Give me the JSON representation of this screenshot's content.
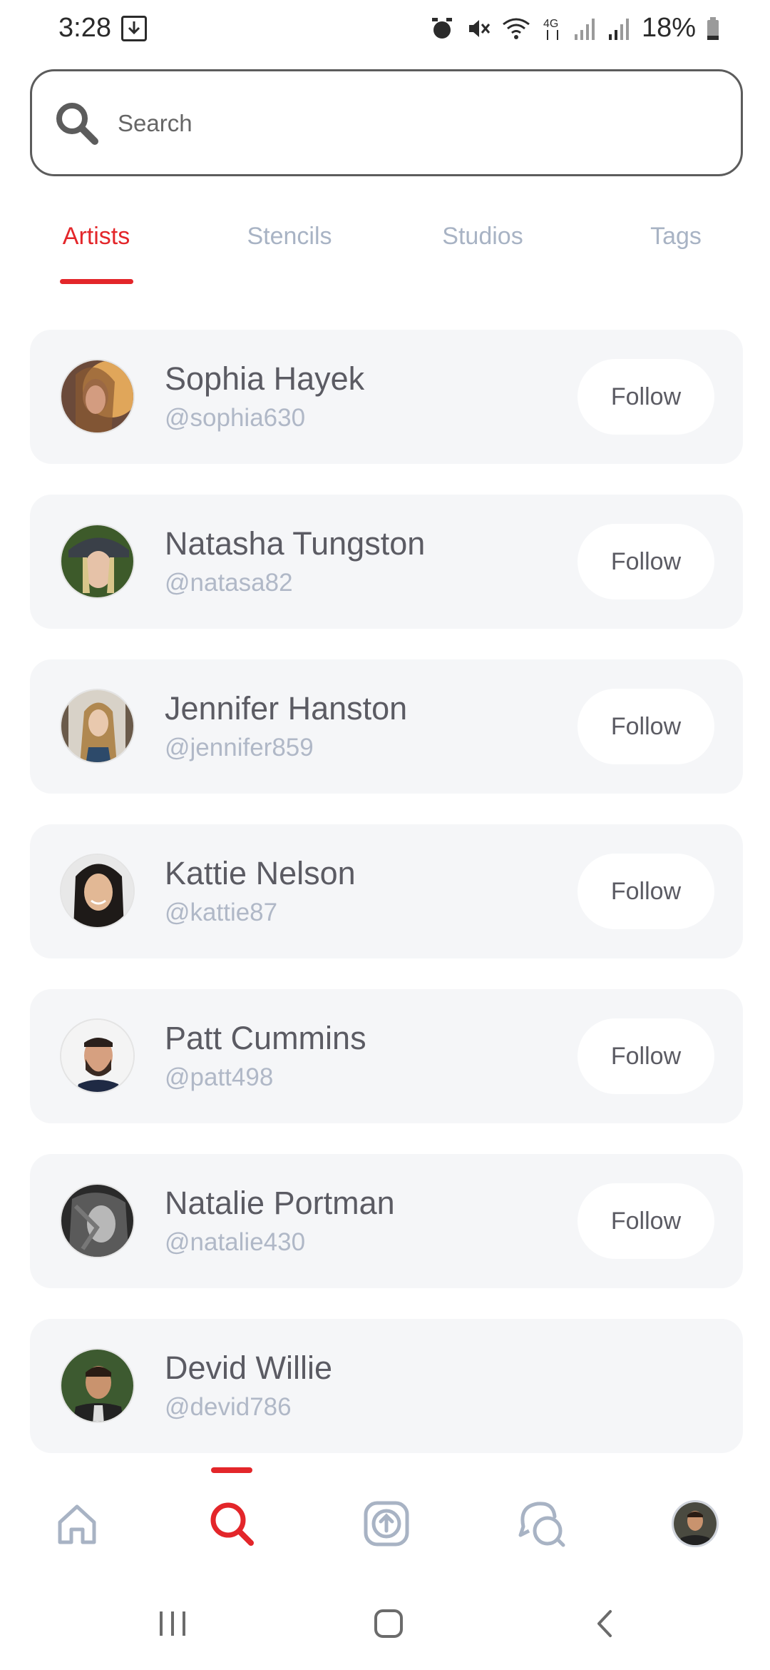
{
  "status_bar": {
    "time": "3:28",
    "battery": "18%",
    "icons": [
      "download-icon",
      "alarm-icon",
      "mute-icon",
      "wifi-icon",
      "4g-icon",
      "signal-icon",
      "signal-icon",
      "battery-icon"
    ]
  },
  "search": {
    "placeholder": "Search"
  },
  "tabs": [
    {
      "label": "Artists",
      "active": true
    },
    {
      "label": "Stencils",
      "active": false
    },
    {
      "label": "Studios",
      "active": false
    },
    {
      "label": "Tags",
      "active": false
    }
  ],
  "artists": [
    {
      "name": "Sophia Hayek",
      "handle": "@sophia630",
      "follow_label": "Follow"
    },
    {
      "name": "Natasha Tungston",
      "handle": "@natasa82",
      "follow_label": "Follow"
    },
    {
      "name": "Jennifer Hanston",
      "handle": "@jennifer859",
      "follow_label": "Follow"
    },
    {
      "name": "Kattie Nelson",
      "handle": "@kattie87",
      "follow_label": "Follow"
    },
    {
      "name": "Patt Cummins",
      "handle": "@patt498",
      "follow_label": "Follow"
    },
    {
      "name": "Natalie Portman",
      "handle": "@natalie430",
      "follow_label": "Follow"
    },
    {
      "name": "Devid Willie",
      "handle": "@devid786",
      "follow_label": ""
    }
  ],
  "bottom_nav": {
    "items": [
      "home-icon",
      "search-icon",
      "upload-icon",
      "chat-icon",
      "profile-avatar"
    ],
    "active": "search-icon"
  },
  "colors": {
    "accent": "#e3262a",
    "inactive": "#a8b3c4",
    "card_bg": "#f5f6f8",
    "text": "#5b5b63",
    "handle": "#b0b8c7"
  }
}
